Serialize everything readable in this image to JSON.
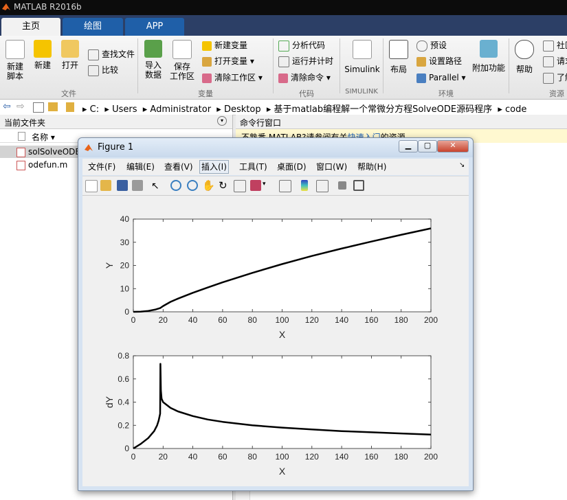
{
  "app": {
    "title": "MATLAB R2016b"
  },
  "tabs": [
    {
      "label": "主页"
    },
    {
      "label": "绘图"
    },
    {
      "label": "APP"
    }
  ],
  "ribbon": {
    "file": {
      "new_script": "新建\n脚本",
      "new": "新建",
      "open": "打开",
      "find_files": "查找文件",
      "compare": "比较",
      "group": "文件"
    },
    "variable": {
      "import": "导入\n数据",
      "save_ws": "保存\n工作区",
      "new_var": "新建变量",
      "open_var": "打开变量",
      "clear_ws": "清除工作区",
      "group": "变量"
    },
    "code": {
      "analyze": "分析代码",
      "run_time": "运行并计时",
      "clear_cmd": "清除命令",
      "group": "代码"
    },
    "simulink": {
      "label": "Simulink",
      "group": "SIMULINK"
    },
    "env": {
      "layout": "布局",
      "prefs": "预设",
      "set_path": "设置路径",
      "parallel": "Parallel",
      "addons": "附加功能",
      "group": "环境"
    },
    "resources": {
      "help": "帮助",
      "community": "社区",
      "request": "请求",
      "learn": "了解",
      "group": "资源"
    }
  },
  "address": {
    "drive": "C:",
    "crumbs": [
      "Users",
      "Administrator",
      "Desktop",
      "基于matlab编程解一个常微分方程SolveODE源码程序",
      "code"
    ]
  },
  "left_panel": {
    "title": "当前文件夹",
    "col_name": "名称 ▾",
    "files": [
      "solSolveODE.m",
      "odefun.m"
    ]
  },
  "cmd_panel": {
    "title": "命令行窗口",
    "msg_prefix": "不熟悉 MATLAB?请参阅有关",
    "msg_link": "快速入门",
    "msg_suffix": "的资源。"
  },
  "figure": {
    "title": "Figure 1",
    "menu": [
      "文件(F)",
      "编辑(E)",
      "查看(V)",
      "插入(I)",
      "工具(T)",
      "桌面(D)",
      "窗口(W)",
      "帮助(H)"
    ],
    "selected_menu": "插入(I)"
  },
  "chart_data": [
    {
      "type": "line",
      "xlabel": "X",
      "ylabel": "Y",
      "xlim": [
        0,
        200
      ],
      "ylim": [
        0,
        40
      ],
      "xticks": [
        0,
        20,
        40,
        60,
        80,
        100,
        120,
        140,
        160,
        180,
        200
      ],
      "yticks": [
        0,
        10,
        20,
        30,
        40
      ],
      "series": [
        {
          "color": "#000000",
          "x": [
            0,
            5,
            10,
            15,
            18,
            20,
            25,
            30,
            40,
            50,
            60,
            80,
            100,
            120,
            140,
            160,
            180,
            200
          ],
          "y": [
            0,
            0.1,
            0.4,
            1.0,
            1.6,
            2.5,
            4.3,
            5.7,
            8.2,
            10.5,
            12.7,
            16.8,
            20.6,
            24.1,
            27.3,
            30.3,
            33.2,
            36.0
          ]
        }
      ]
    },
    {
      "type": "line",
      "xlabel": "X",
      "ylabel": "dY",
      "xlim": [
        0,
        200
      ],
      "ylim": [
        0,
        0.8
      ],
      "xticks": [
        0,
        20,
        40,
        60,
        80,
        100,
        120,
        140,
        160,
        180,
        200
      ],
      "yticks": [
        0,
        0.2,
        0.4,
        0.6,
        0.8
      ],
      "series": [
        {
          "color": "#000000",
          "x": [
            0,
            5,
            10,
            14,
            16,
            17,
            18,
            18.2,
            18.5,
            19,
            20,
            25,
            30,
            40,
            50,
            60,
            80,
            100,
            120,
            140,
            160,
            180,
            200
          ],
          "y": [
            0,
            0.04,
            0.09,
            0.15,
            0.2,
            0.24,
            0.3,
            0.73,
            0.5,
            0.43,
            0.4,
            0.35,
            0.32,
            0.28,
            0.25,
            0.23,
            0.2,
            0.18,
            0.165,
            0.15,
            0.14,
            0.13,
            0.12
          ]
        }
      ]
    }
  ]
}
